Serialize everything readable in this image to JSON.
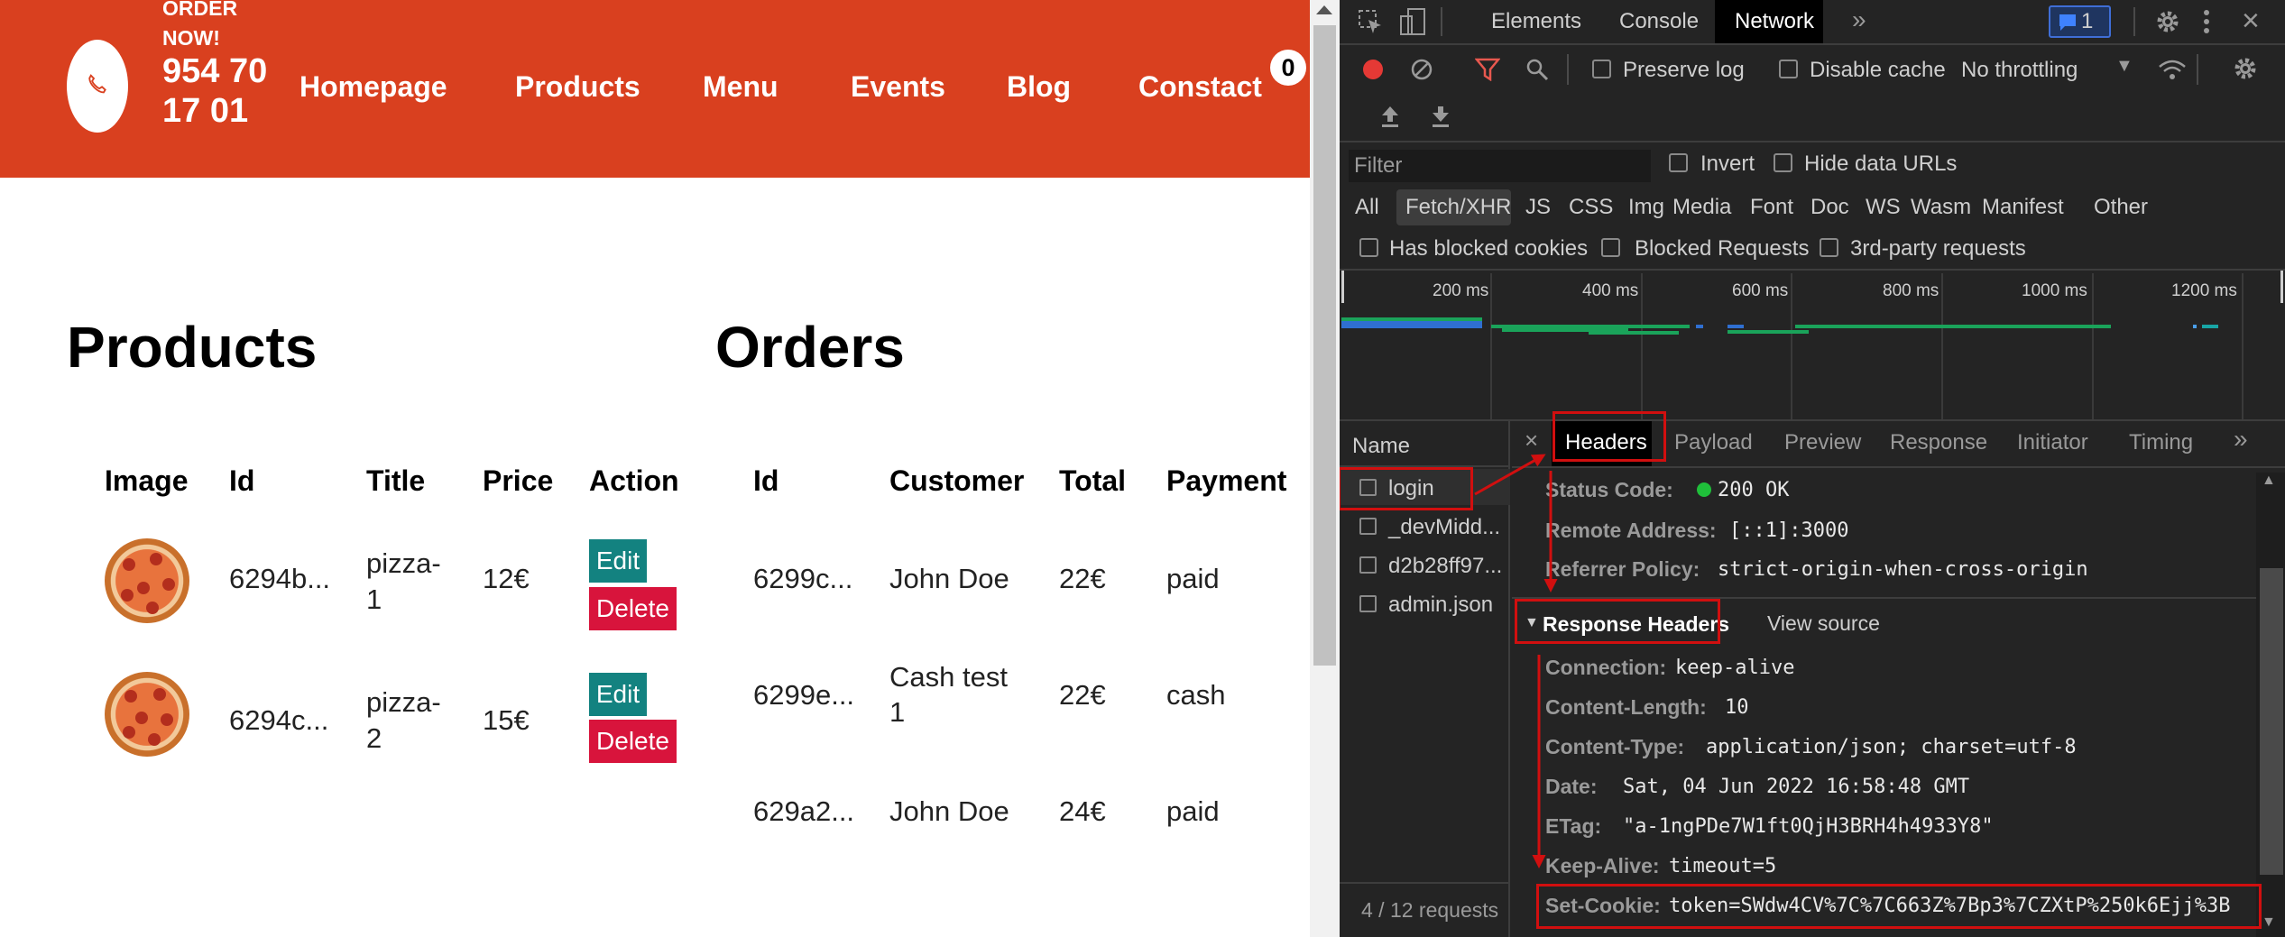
{
  "header": {
    "order_now": "ORDER NOW!",
    "phone": "954 70 17 01",
    "nav": [
      "Homepage",
      "Products",
      "Menu",
      "Events",
      "Blog",
      "Constact"
    ],
    "cart_count": "0"
  },
  "products": {
    "title": "Products",
    "columns": [
      "Image",
      "Id",
      "Title",
      "Price",
      "Action"
    ],
    "rows": [
      {
        "id": "6294b...",
        "title_line1": "pizza-",
        "title_line2": "1",
        "price": "12€"
      },
      {
        "id": "6294c...",
        "title_line1": "pizza-",
        "title_line2": "2",
        "price": "15€"
      }
    ],
    "edit_label": "Edit",
    "delete_label": "Delete"
  },
  "orders": {
    "title": "Orders",
    "columns": [
      "Id",
      "Customer",
      "Total",
      "Payment"
    ],
    "rows": [
      {
        "id": "6299c...",
        "customer_line1": "John Doe",
        "customer_line2": "",
        "total": "22€",
        "payment": "paid"
      },
      {
        "id": "6299e...",
        "customer_line1": "Cash test",
        "customer_line2": "1",
        "total": "22€",
        "payment": "cash"
      },
      {
        "id": "629a2...",
        "customer_line1": "John Doe",
        "customer_line2": "",
        "total": "24€",
        "payment": "paid"
      }
    ]
  },
  "devtools": {
    "tabs": [
      "Elements",
      "Console",
      "Network"
    ],
    "active_tab": "Network",
    "issues_count": "1",
    "toolbar": {
      "preserve_log": "Preserve log",
      "disable_cache": "Disable cache",
      "throttling": "No throttling"
    },
    "filter": {
      "placeholder": "Filter",
      "invert": "Invert",
      "hide_data_urls": "Hide data URLs",
      "types": [
        "All",
        "Fetch/XHR",
        "JS",
        "CSS",
        "Img",
        "Media",
        "Font",
        "Doc",
        "WS",
        "Wasm",
        "Manifest",
        "Other"
      ],
      "active_type": "Fetch/XHR",
      "has_blocked_cookies": "Has blocked cookies",
      "blocked_requests": "Blocked Requests",
      "third_party": "3rd-party requests"
    },
    "timeline_ticks": [
      "200 ms",
      "400 ms",
      "600 ms",
      "800 ms",
      "1000 ms",
      "1200 ms"
    ],
    "name_header": "Name",
    "requests": [
      "login",
      "_devMidd...",
      "d2b28ff97...",
      "admin.json"
    ],
    "status_bar": "4 / 12 requests",
    "detail_tabs": [
      "Headers",
      "Payload",
      "Preview",
      "Response",
      "Initiator",
      "Timing"
    ],
    "active_detail_tab": "Headers",
    "general": [
      {
        "key": "Status Code:",
        "value": "200 OK"
      },
      {
        "key": "Remote Address:",
        "value": "[::1]:3000"
      },
      {
        "key": "Referrer Policy:",
        "value": "strict-origin-when-cross-origin"
      }
    ],
    "response_headers_title": "Response Headers",
    "view_source": "View source",
    "response_headers": [
      {
        "key": "Connection:",
        "value": "keep-alive"
      },
      {
        "key": "Content-Length:",
        "value": "10"
      },
      {
        "key": "Content-Type:",
        "value": "application/json; charset=utf-8"
      },
      {
        "key": "Date:",
        "value": "Sat, 04 Jun 2022 16:58:48 GMT"
      },
      {
        "key": "ETag:",
        "value": "\"a-1ngPDe7W1ft0QjH3BRH4h4933Y8\""
      },
      {
        "key": "Keep-Alive:",
        "value": "timeout=5"
      },
      {
        "key": "Set-Cookie:",
        "value": "token=SWdw4CV%7C%7C663Z%7Bp3%7CZXtP%250k6Ejj%3B"
      }
    ],
    "colors": {
      "status_ok": "#1fbf3a",
      "annotation": "#d10f0f",
      "record": "#e53935",
      "filter_icon": "#e8584f"
    }
  }
}
